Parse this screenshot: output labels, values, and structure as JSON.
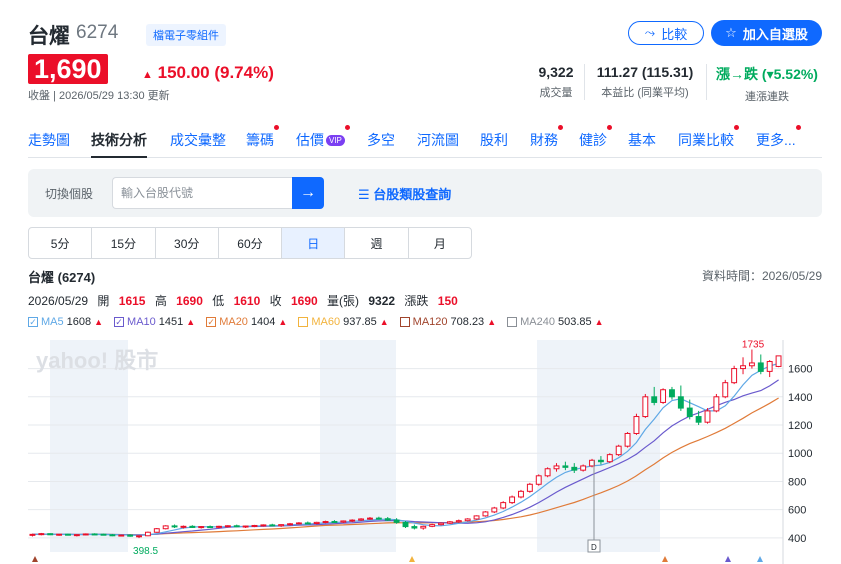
{
  "stock": {
    "name": "台燿",
    "code": "6274",
    "tag": "檔電子零組件",
    "price": "1,690",
    "change": "150.00 (9.74%)",
    "updated": "收盤 | 2026/05/29 13:30 更新"
  },
  "actions": {
    "compare": "比較",
    "watchlist": "加入自選股"
  },
  "stats": [
    {
      "value": "9,322",
      "label": "成交量"
    },
    {
      "value": "111.27 (115.31)",
      "label": "本益比 (同業平均)"
    },
    {
      "value": "漲→跌 (▾5.52%)",
      "label": "連漲連跌"
    }
  ],
  "tabs": [
    {
      "label": "走勢圖",
      "dot": false
    },
    {
      "label": "技術分析",
      "dot": false,
      "active": true
    },
    {
      "label": "成交彙整",
      "dot": false
    },
    {
      "label": "籌碼",
      "dot": true
    },
    {
      "label": "估價",
      "dot": true,
      "vip": "VIP"
    },
    {
      "label": "多空",
      "dot": false
    },
    {
      "label": "河流圖",
      "dot": false
    },
    {
      "label": "股利",
      "dot": false
    },
    {
      "label": "財務",
      "dot": true
    },
    {
      "label": "健診",
      "dot": true
    },
    {
      "label": "基本",
      "dot": false
    },
    {
      "label": "同業比較",
      "dot": true
    },
    {
      "label": "更多...",
      "dot": true
    }
  ],
  "search": {
    "label": "切換個股",
    "placeholder": "輸入台股代號",
    "link": "台股類股查詢"
  },
  "periods": [
    "5分",
    "15分",
    "30分",
    "60分",
    "日",
    "週",
    "月"
  ],
  "active_period": "日",
  "chart_header": {
    "title": "台燿 (6274)",
    "data_time": "資料時間：2026/05/29",
    "date": "2026/05/29",
    "open_label": "開",
    "open": "1615",
    "high_label": "高",
    "high": "1690",
    "low_label": "低",
    "low": "1610",
    "close_label": "收",
    "close": "1690",
    "volume_label": "量(張)",
    "volume": "9322",
    "change_label": "漲跌",
    "change": "150"
  },
  "colors": {
    "up": "#eb0f29",
    "down": "#00ab5e",
    "accent": "#0f69ff",
    "ma5": "#5fa8e6",
    "ma10": "#6a5acd",
    "ma20": "#e07b39",
    "ma60": "#f2b33d",
    "ma120": "#a0442c",
    "ma240": "#8a8f96"
  },
  "chart_data": {
    "type": "candlestick",
    "watermark": "yahoo! 股市",
    "ma_legend": [
      {
        "name": "MA5",
        "value": "1608",
        "checked": true,
        "color": "#5fa8e6"
      },
      {
        "name": "MA10",
        "value": "1451",
        "checked": true,
        "color": "#6a5acd"
      },
      {
        "name": "MA20",
        "value": "1404",
        "checked": true,
        "color": "#e07b39"
      },
      {
        "name": "MA60",
        "value": "937.85",
        "checked": false,
        "color": "#f2b33d"
      },
      {
        "name": "MA120",
        "value": "708.23",
        "checked": false,
        "color": "#a0442c"
      },
      {
        "name": "MA240",
        "value": "503.85",
        "checked": false,
        "color": "#8a8f96"
      }
    ],
    "ylim": [
      300,
      1760
    ],
    "yticks": [
      400,
      600,
      800,
      1000,
      1200,
      1400,
      1600
    ],
    "max_label": "1735",
    "min_label": "398.5",
    "marker_label": "D",
    "candles": [
      [
        420,
        430,
        410,
        425
      ],
      [
        425,
        435,
        418,
        430
      ],
      [
        430,
        432,
        420,
        422
      ],
      [
        422,
        428,
        415,
        426
      ],
      [
        426,
        430,
        418,
        420
      ],
      [
        420,
        425,
        410,
        423
      ],
      [
        423,
        432,
        418,
        428
      ],
      [
        428,
        433,
        422,
        426
      ],
      [
        426,
        430,
        418,
        422
      ],
      [
        422,
        428,
        412,
        418
      ],
      [
        418,
        424,
        410,
        420
      ],
      [
        420,
        426,
        408,
        412
      ],
      [
        412,
        418,
        398.5,
        415
      ],
      [
        415,
        445,
        412,
        440
      ],
      [
        440,
        470,
        436,
        465
      ],
      [
        465,
        490,
        460,
        485
      ],
      [
        485,
        495,
        470,
        478
      ],
      [
        478,
        488,
        466,
        482
      ],
      [
        482,
        490,
        470,
        474
      ],
      [
        474,
        484,
        466,
        480
      ],
      [
        480,
        488,
        470,
        476
      ],
      [
        476,
        486,
        468,
        482
      ],
      [
        482,
        490,
        474,
        486
      ],
      [
        486,
        494,
        476,
        480
      ],
      [
        480,
        488,
        470,
        484
      ],
      [
        484,
        492,
        476,
        488
      ],
      [
        488,
        496,
        480,
        492
      ],
      [
        492,
        500,
        484,
        486
      ],
      [
        486,
        496,
        478,
        494
      ],
      [
        494,
        506,
        488,
        500
      ],
      [
        500,
        512,
        494,
        506
      ],
      [
        506,
        516,
        498,
        502
      ],
      [
        502,
        514,
        496,
        510
      ],
      [
        510,
        522,
        504,
        516
      ],
      [
        516,
        526,
        508,
        512
      ],
      [
        512,
        524,
        506,
        520
      ],
      [
        520,
        532,
        512,
        526
      ],
      [
        526,
        540,
        520,
        534
      ],
      [
        534,
        548,
        528,
        540
      ],
      [
        540,
        550,
        530,
        536
      ],
      [
        536,
        548,
        520,
        526
      ],
      [
        526,
        540,
        500,
        510
      ],
      [
        510,
        520,
        470,
        480
      ],
      [
        480,
        494,
        460,
        470
      ],
      [
        470,
        486,
        458,
        482
      ],
      [
        482,
        500,
        476,
        494
      ],
      [
        494,
        510,
        488,
        504
      ],
      [
        504,
        520,
        498,
        514
      ],
      [
        514,
        530,
        506,
        522
      ],
      [
        522,
        540,
        516,
        534
      ],
      [
        534,
        560,
        528,
        556
      ],
      [
        556,
        590,
        550,
        584
      ],
      [
        584,
        620,
        576,
        612
      ],
      [
        612,
        660,
        604,
        650
      ],
      [
        650,
        700,
        640,
        690
      ],
      [
        690,
        740,
        680,
        730
      ],
      [
        730,
        790,
        720,
        780
      ],
      [
        780,
        850,
        770,
        840
      ],
      [
        840,
        900,
        830,
        890
      ],
      [
        890,
        930,
        870,
        910
      ],
      [
        910,
        940,
        880,
        900
      ],
      [
        900,
        930,
        860,
        880
      ],
      [
        880,
        920,
        870,
        910
      ],
      [
        910,
        960,
        900,
        950
      ],
      [
        950,
        980,
        920,
        940
      ],
      [
        940,
        1000,
        930,
        990
      ],
      [
        990,
        1060,
        980,
        1050
      ],
      [
        1050,
        1150,
        1040,
        1140
      ],
      [
        1140,
        1280,
        1130,
        1260
      ],
      [
        1260,
        1420,
        1250,
        1400
      ],
      [
        1400,
        1470,
        1340,
        1360
      ],
      [
        1360,
        1460,
        1350,
        1450
      ],
      [
        1450,
        1470,
        1380,
        1400
      ],
      [
        1400,
        1480,
        1300,
        1320
      ],
      [
        1320,
        1380,
        1240,
        1260
      ],
      [
        1260,
        1300,
        1200,
        1220
      ],
      [
        1220,
        1320,
        1210,
        1300
      ],
      [
        1300,
        1420,
        1290,
        1400
      ],
      [
        1400,
        1520,
        1390,
        1500
      ],
      [
        1500,
        1620,
        1490,
        1600
      ],
      [
        1600,
        1680,
        1560,
        1620
      ],
      [
        1620,
        1735,
        1600,
        1640
      ],
      [
        1640,
        1700,
        1560,
        1580
      ],
      [
        1580,
        1660,
        1540,
        1650
      ],
      [
        1615,
        1690,
        1610,
        1690
      ]
    ]
  }
}
